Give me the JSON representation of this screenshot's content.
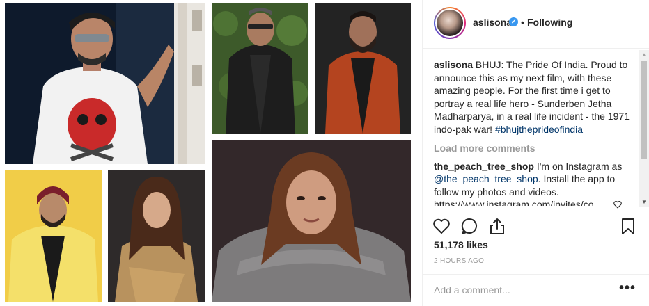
{
  "post": {
    "username": "aslisona",
    "verified_badge": "✔",
    "separator": "•",
    "follow_status": "Following",
    "caption_user": "aslisona",
    "caption_text": "BHUJ: The Pride Of India. Proud to announce this as my next film, with these amazing people. For the first time i get to portray a real life hero - Sunderben Jetha Madharparya, in a real life incident - the 1971 indo-pak war! ",
    "caption_hashtag": "#bhujtheprideofindia",
    "load_more": "Load more comments",
    "comment_user": "the_peach_tree_shop",
    "comment_text_1": "I'm on Instagram as ",
    "comment_mention": "@the_peach_tree_shop",
    "comment_text_2": ". Install the app to follow my photos and videos. https://www.instagram.com/invites/co",
    "likes": "51,178 likes",
    "timestamp": "2 HOURS AGO",
    "add_comment_placeholder": "Add a comment...",
    "more_options": "•••"
  },
  "icons": {
    "like": "heart-icon",
    "comment": "comment-icon",
    "share": "share-icon",
    "save": "bookmark-icon",
    "comment_like": "small-heart-icon"
  },
  "colors": {
    "text": "#262626",
    "muted": "#999999",
    "link": "#003569",
    "verified": "#3897f0",
    "border": "#efefef"
  }
}
